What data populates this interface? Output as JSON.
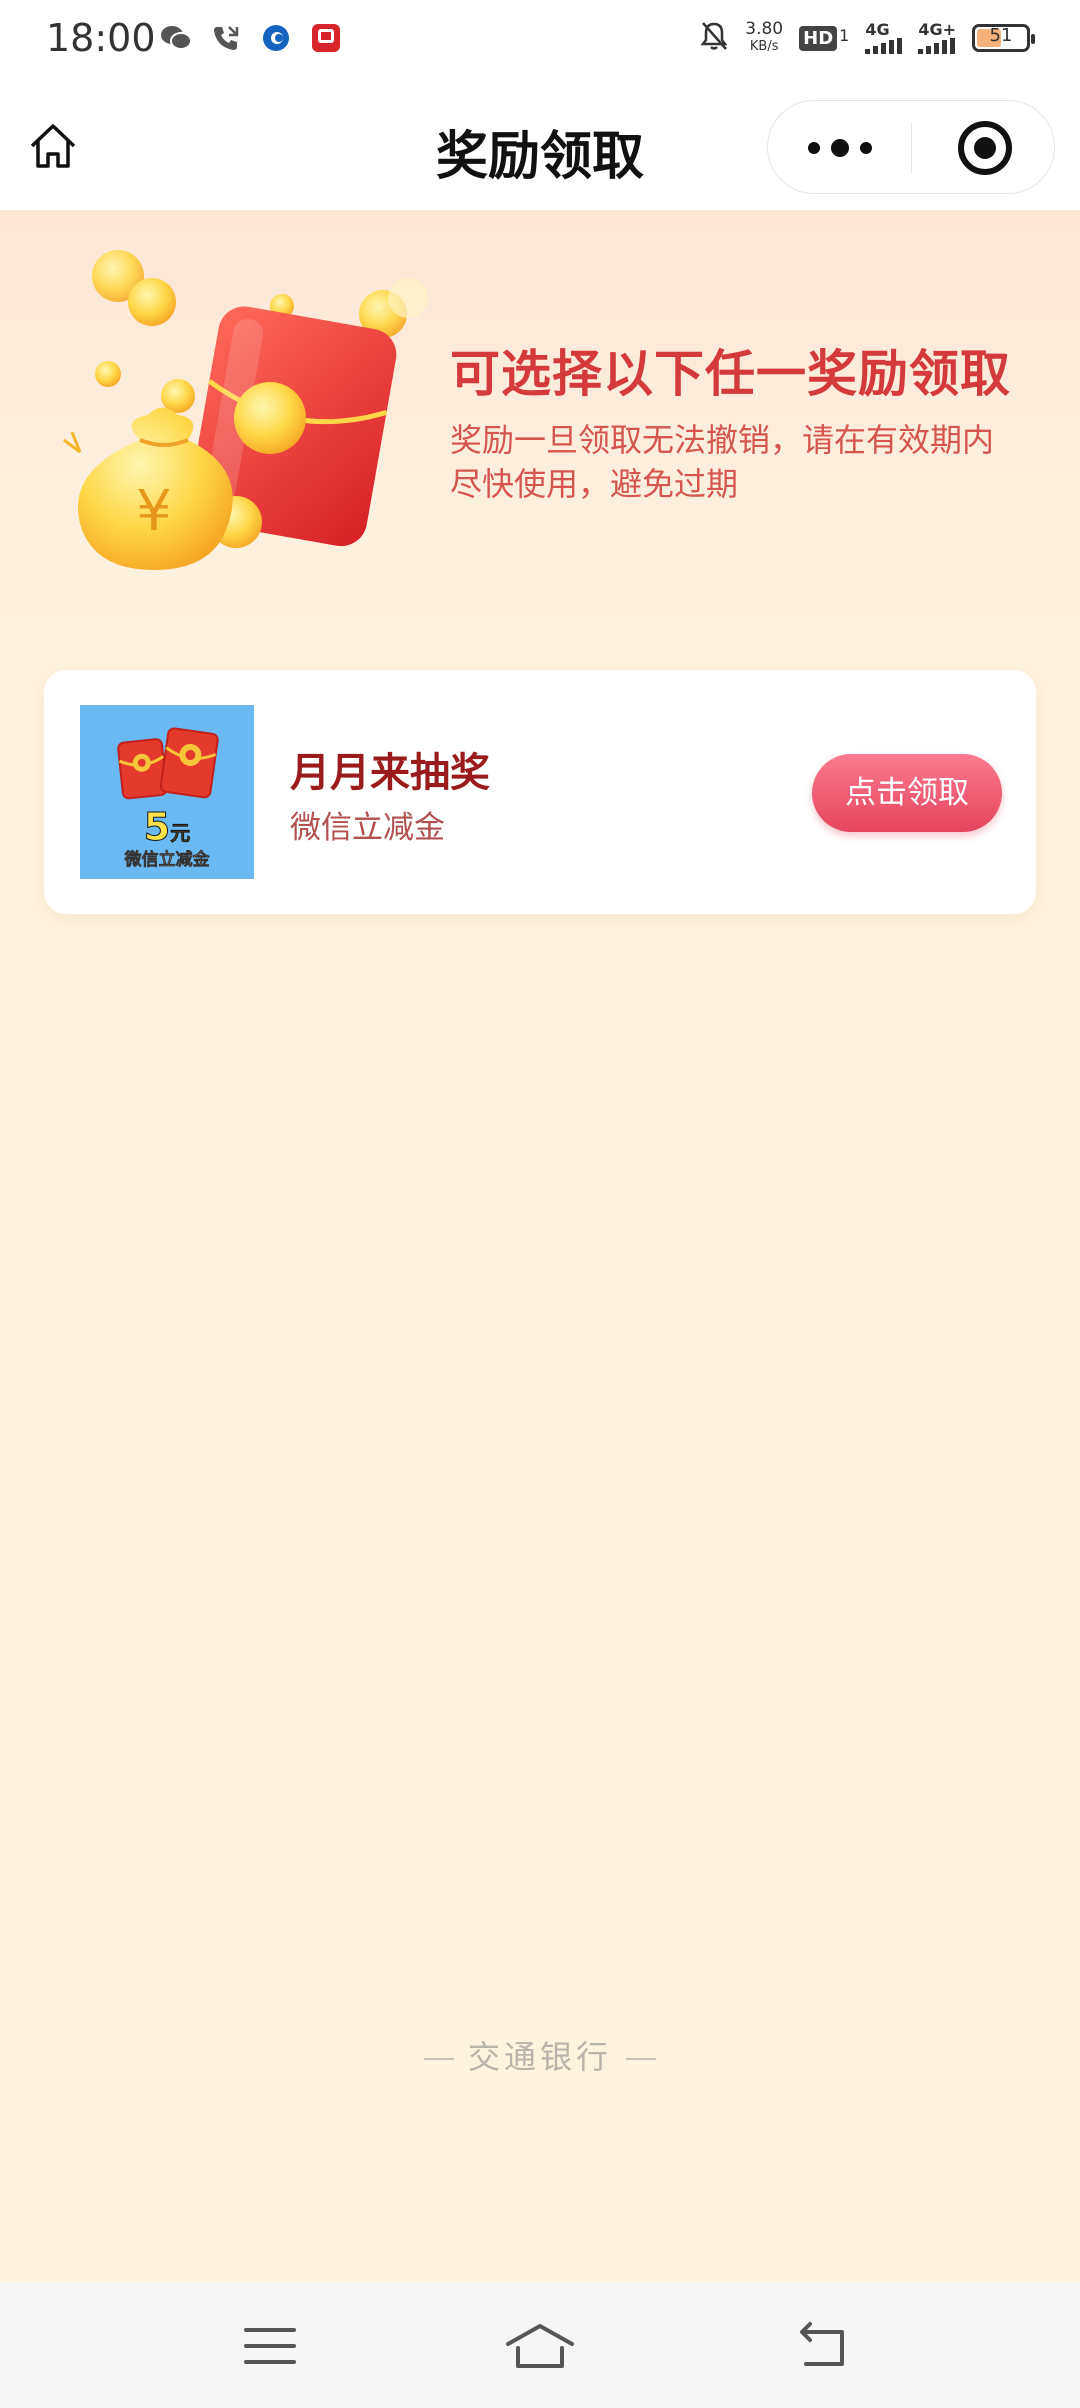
{
  "status_bar": {
    "time": "18:00",
    "net_speed_value": "3.80",
    "net_speed_unit": "KB/s",
    "hd_label": "HD",
    "hd_sub": "1",
    "sim_label": "4G",
    "sim2_label": "4G+",
    "battery": "51"
  },
  "navbar": {
    "title": "奖励领取"
  },
  "hero": {
    "title": "可选择以下任一奖励领取",
    "description": "奖励一旦领取无法撤销，请在有效期内尽快使用，避免过期"
  },
  "reward_card": {
    "thumb_amount": "5",
    "thumb_unit": "元",
    "thumb_caption": "微信立减金",
    "title": "月月来抽奖",
    "subtitle": "微信立减金",
    "button_label": "点击领取"
  },
  "footer": {
    "brand": "交通银行"
  },
  "colors": {
    "page_bg": "#fdf3df",
    "hero_title": "#d43a3a",
    "card_title": "#9a1b1b",
    "button": "#e5455e"
  }
}
